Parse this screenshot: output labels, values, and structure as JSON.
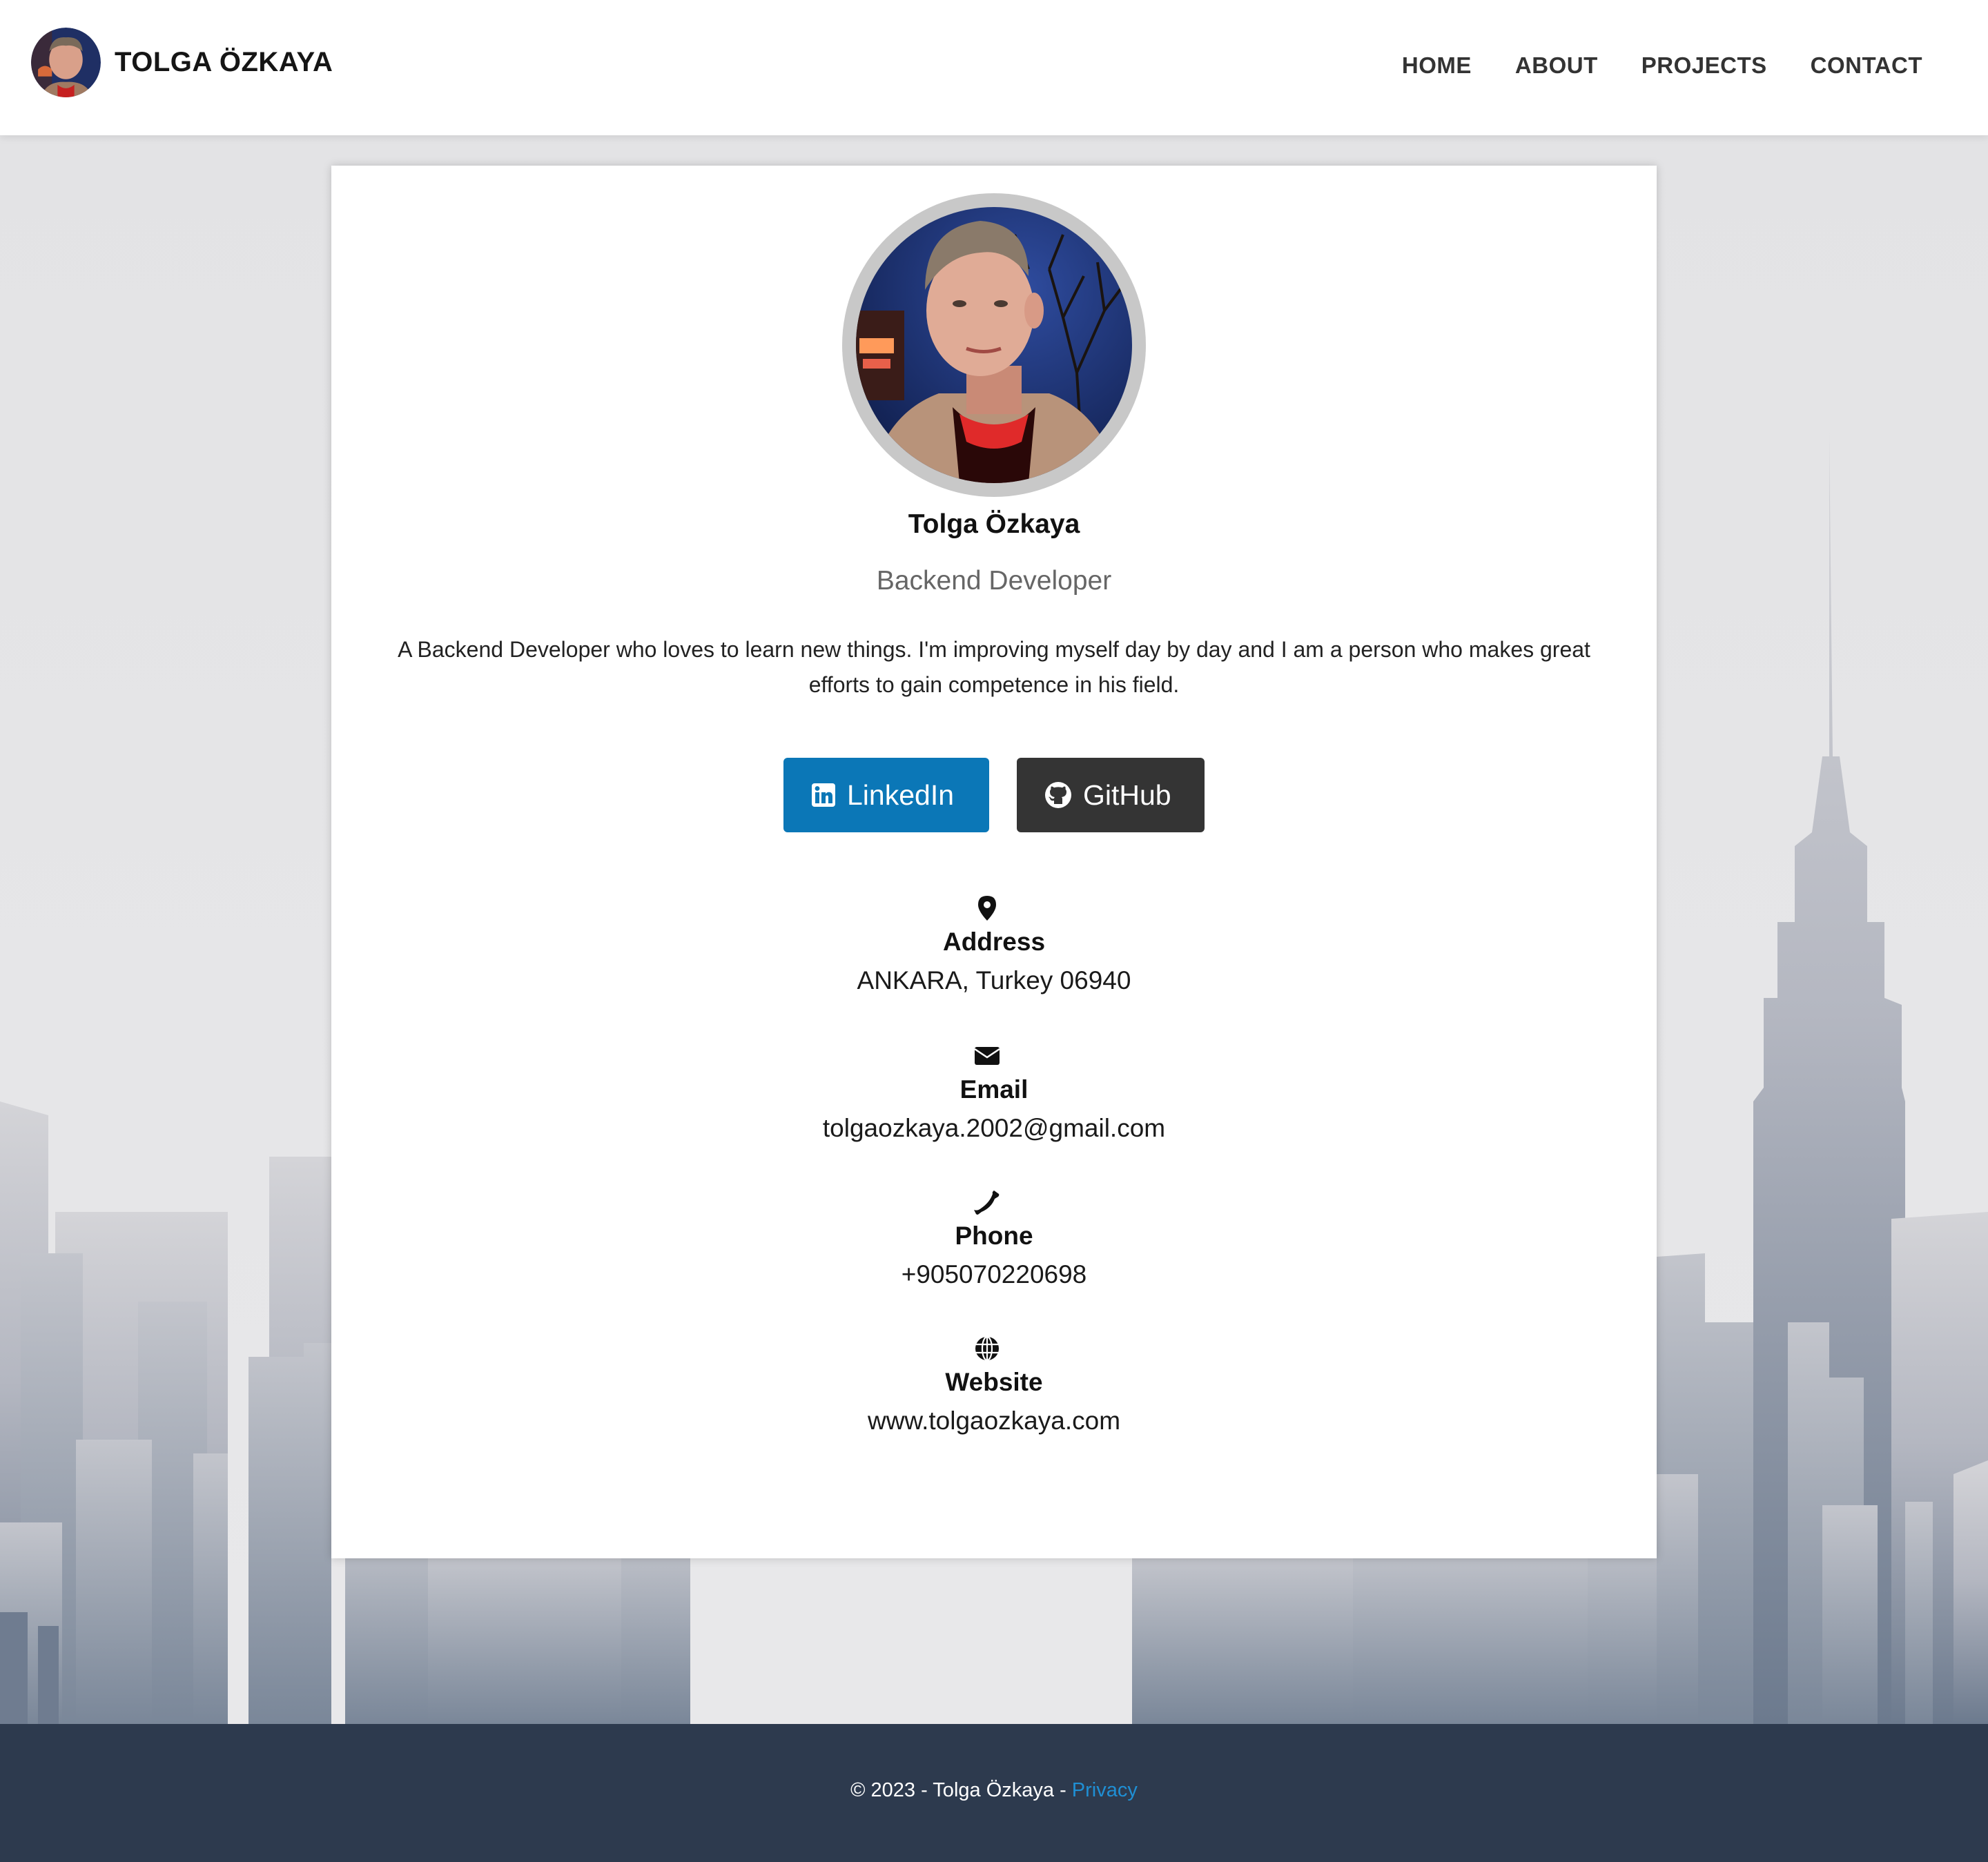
{
  "header": {
    "brand_name": "TOLGA ÖZKAYA",
    "avatar_icon": "profile-photo",
    "nav": [
      {
        "label": "HOME"
      },
      {
        "label": "ABOUT"
      },
      {
        "label": "PROJECTS"
      },
      {
        "label": "CONTACT"
      }
    ]
  },
  "profile": {
    "name": "Tolga Özkaya",
    "role": "Backend Developer",
    "bio": "A Backend Developer who loves to learn new things. I'm improving myself day by day and I am a person who makes great efforts to gain competence in his field."
  },
  "buttons": {
    "linkedin": {
      "label": "LinkedIn",
      "icon": "linkedin-icon",
      "color": "#0b77b7"
    },
    "github": {
      "label": "GitHub",
      "icon": "github-icon",
      "color": "#343434"
    }
  },
  "contact": {
    "address": {
      "label": "Address",
      "value": "ANKARA, Turkey 06940",
      "icon": "map-marker-icon"
    },
    "email": {
      "label": "Email",
      "value": "tolgaozkaya.2002@gmail.com",
      "icon": "envelope-icon"
    },
    "phone": {
      "label": "Phone",
      "value": "+905070220698",
      "icon": "phone-icon"
    },
    "website": {
      "label": "Website",
      "value": "www.tolgaozkaya.com",
      "icon": "globe-icon"
    }
  },
  "footer": {
    "copyright": "© 2023 - Tolga Özkaya - ",
    "privacy_label": "Privacy"
  },
  "colors": {
    "footer_bg": "#2d3a4e",
    "link": "#1f8fd4",
    "linkedin": "#0b77b7",
    "github": "#343434"
  }
}
